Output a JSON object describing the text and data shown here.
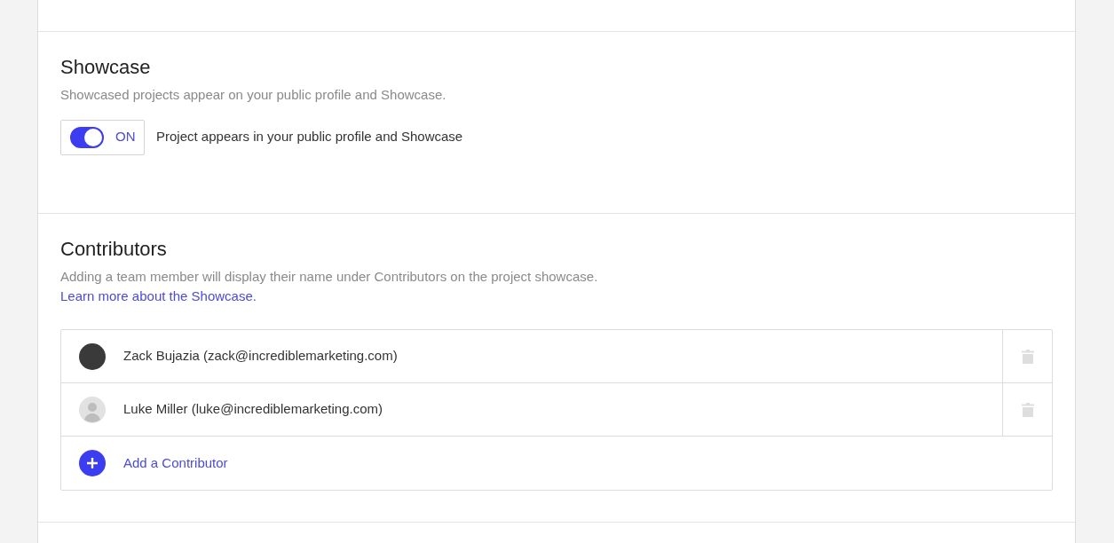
{
  "showcase": {
    "title": "Showcase",
    "description": "Showcased projects appear on your public profile and Showcase.",
    "toggle": {
      "on": true,
      "label": "ON"
    },
    "toggle_caption": "Project appears in your public profile and Showcase"
  },
  "contributors": {
    "title": "Contributors",
    "description": "Adding a team member will display their name under Contributors on the project showcase.",
    "link": "Learn more about the Showcase.",
    "members": [
      {
        "label": "Zack Bujazia (zack@incrediblemarketing.com)",
        "kind": "photo"
      },
      {
        "label": "Luke Miller (luke@incrediblemarketing.com)",
        "kind": "default"
      }
    ],
    "add_label": "Add a Contributor"
  }
}
